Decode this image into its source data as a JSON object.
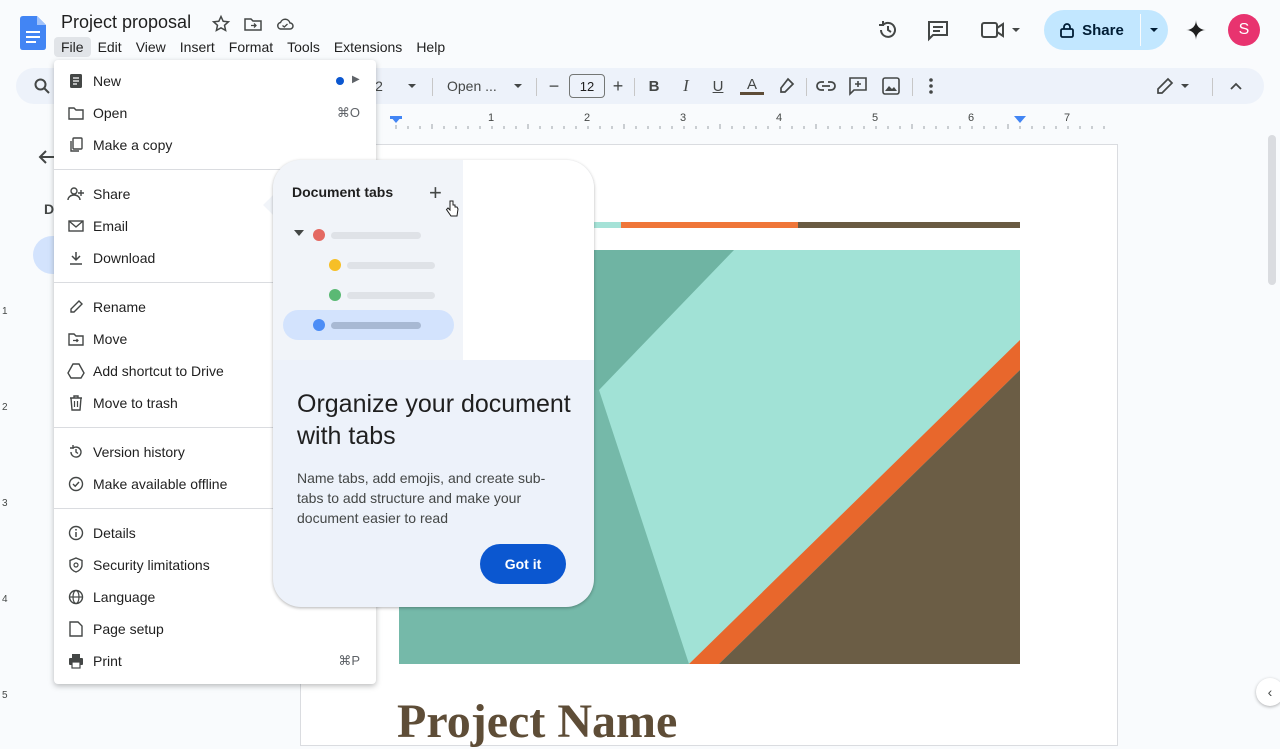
{
  "app": {
    "title": "Project proposal",
    "menus": [
      "File",
      "Edit",
      "View",
      "Insert",
      "Format",
      "Tools",
      "Extensions",
      "Help"
    ],
    "active_menu": "File",
    "share_label": "Share",
    "avatar_initial": "S"
  },
  "toolbar": {
    "zoom_partial": "2",
    "font_name": "Open ...",
    "font_size": "12",
    "bold": "B",
    "italic": "I",
    "underline": "U",
    "text_color": "A"
  },
  "ruler": {
    "numbers": [
      "1",
      "2",
      "3",
      "4",
      "5",
      "6",
      "7"
    ]
  },
  "vruler": {
    "numbers": [
      "1",
      "2",
      "3",
      "4",
      "5"
    ]
  },
  "sidepanel": {
    "letter": "D"
  },
  "file_menu": {
    "items": [
      {
        "label": "New",
        "icon": "doc-icon",
        "shortcut": ""
      },
      {
        "label": "Open",
        "icon": "folder-icon",
        "shortcut": "⌘O"
      },
      {
        "label": "Make a copy",
        "icon": "copy-icon",
        "shortcut": ""
      },
      {
        "label": "Share",
        "icon": "person-add-icon",
        "shortcut": ""
      },
      {
        "label": "Email",
        "icon": "mail-icon",
        "shortcut": ""
      },
      {
        "label": "Download",
        "icon": "download-icon",
        "shortcut": ""
      },
      {
        "label": "Rename",
        "icon": "pencil-icon",
        "shortcut": ""
      },
      {
        "label": "Move",
        "icon": "move-folder-icon",
        "shortcut": ""
      },
      {
        "label": "Add shortcut to Drive",
        "icon": "drive-shortcut-icon",
        "shortcut": ""
      },
      {
        "label": "Move to trash",
        "icon": "trash-icon",
        "shortcut": ""
      },
      {
        "label": "Version history",
        "icon": "history-icon",
        "shortcut": ""
      },
      {
        "label": "Make available offline",
        "icon": "offline-icon",
        "shortcut": ""
      },
      {
        "label": "Details",
        "icon": "info-icon",
        "shortcut": ""
      },
      {
        "label": "Security limitations",
        "icon": "shield-icon",
        "shortcut": ""
      },
      {
        "label": "Language",
        "icon": "globe-icon",
        "shortcut": ""
      },
      {
        "label": "Page setup",
        "icon": "page-icon",
        "shortcut": ""
      },
      {
        "label": "Print",
        "icon": "printer-icon",
        "shortcut": "⌘P"
      }
    ]
  },
  "callout": {
    "panel_title": "Document tabs",
    "heading": "Organize your document with tabs",
    "body": "Name tabs, add emojis, and create sub-tabs to add structure and make your document easier to read",
    "button": "Got it",
    "dot_colors": [
      "#e46962",
      "#f6bf26",
      "#5bb974",
      "#4c8df6"
    ]
  },
  "document": {
    "heading": "Project Name",
    "strip_colors": [
      "#a5e2d7",
      "#ef7639",
      "#695a42"
    ],
    "image_colors": [
      "#75b9a9",
      "#a1e2d6",
      "#e8672c",
      "#6b5d45"
    ]
  }
}
